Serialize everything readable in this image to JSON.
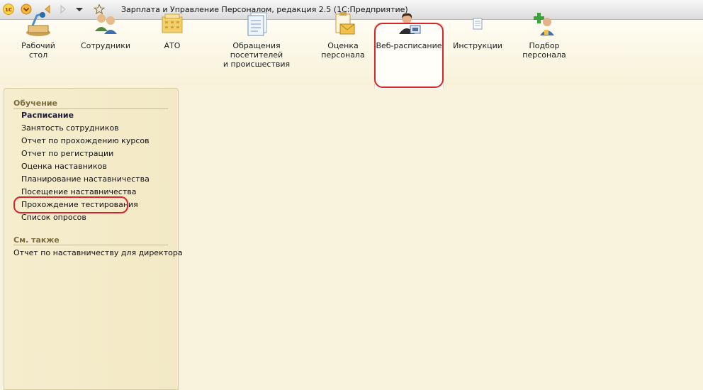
{
  "window": {
    "title": "Зарплата и Управление Персоналом, редакция 2.5  (1С:Предприятие)"
  },
  "toolbar_icons": [
    "1c-logo-icon",
    "main-menu-icon",
    "back-arrow-icon",
    "forward-arrow-icon",
    "history-dropdown-icon",
    "favorites-star-icon"
  ],
  "panel": {
    "items": [
      {
        "label": "Рабочий\nстол",
        "icon": "desktop-lamp-icon"
      },
      {
        "label": "Сотрудники",
        "icon": "employees-icon"
      },
      {
        "label": "АТО",
        "icon": "ato-icon"
      },
      {
        "label": "Обращения посетителей\nи происшествия",
        "icon": "documents-icon"
      },
      {
        "label": "Оценка\nперсонала",
        "icon": "evaluation-icon"
      },
      {
        "label": "Веб-расписание",
        "icon": "web-schedule-icon"
      },
      {
        "label": "Инструкции",
        "icon": "instructions-icon"
      },
      {
        "label": "Подбор\nперсонала",
        "icon": "recruitment-icon"
      }
    ]
  },
  "nav": {
    "group_title": "Обучение",
    "items": [
      "Расписание",
      "Занятость сотрудников",
      "Отчет по прохождению курсов",
      "Отчет по регистрации",
      "Оценка наставников",
      "Планирование наставничества",
      "Посещение наставничества",
      "Прохождение тестирования",
      "Список опросов"
    ],
    "see_also_title": "См. также",
    "see_also": [
      "Отчет по наставничеству для директора"
    ]
  },
  "colors": {
    "highlight": "#d8252b",
    "background": "#f9f3dd"
  }
}
